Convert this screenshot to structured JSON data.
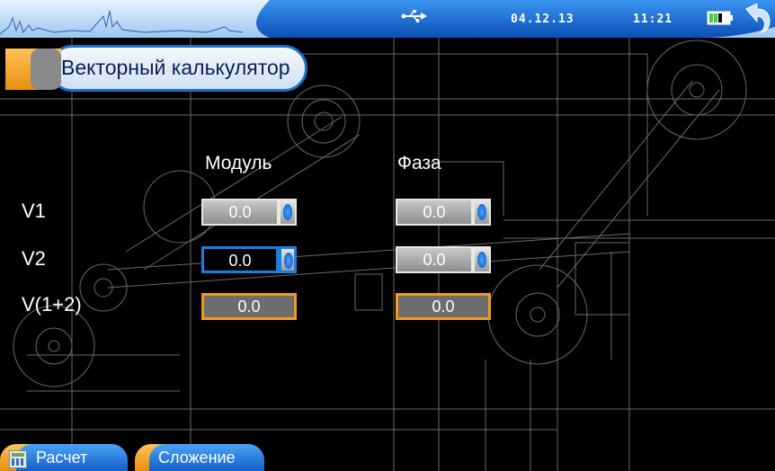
{
  "status": {
    "date": "04.12.13",
    "time": "11:21"
  },
  "title": "Векторный калькулятор",
  "headers": {
    "modulus": "Модуль",
    "phase": "Фаза"
  },
  "rows": [
    {
      "label": "V1",
      "modulus": "0.0",
      "phase": "0.0"
    },
    {
      "label": "V2",
      "modulus": "0.0",
      "phase": "0.0"
    },
    {
      "label": "V(1+2)",
      "modulus": "0.0",
      "phase": "0.0"
    }
  ],
  "softkeys": {
    "calculate": "Расчет",
    "addition": "Сложение"
  },
  "colors": {
    "accent_blue": "#1a7fe0",
    "accent_orange": "#f29a1c",
    "battery": "#3fd13f"
  },
  "icons": [
    "usb-icon",
    "battery-icon",
    "back-icon",
    "calculator-icon"
  ]
}
